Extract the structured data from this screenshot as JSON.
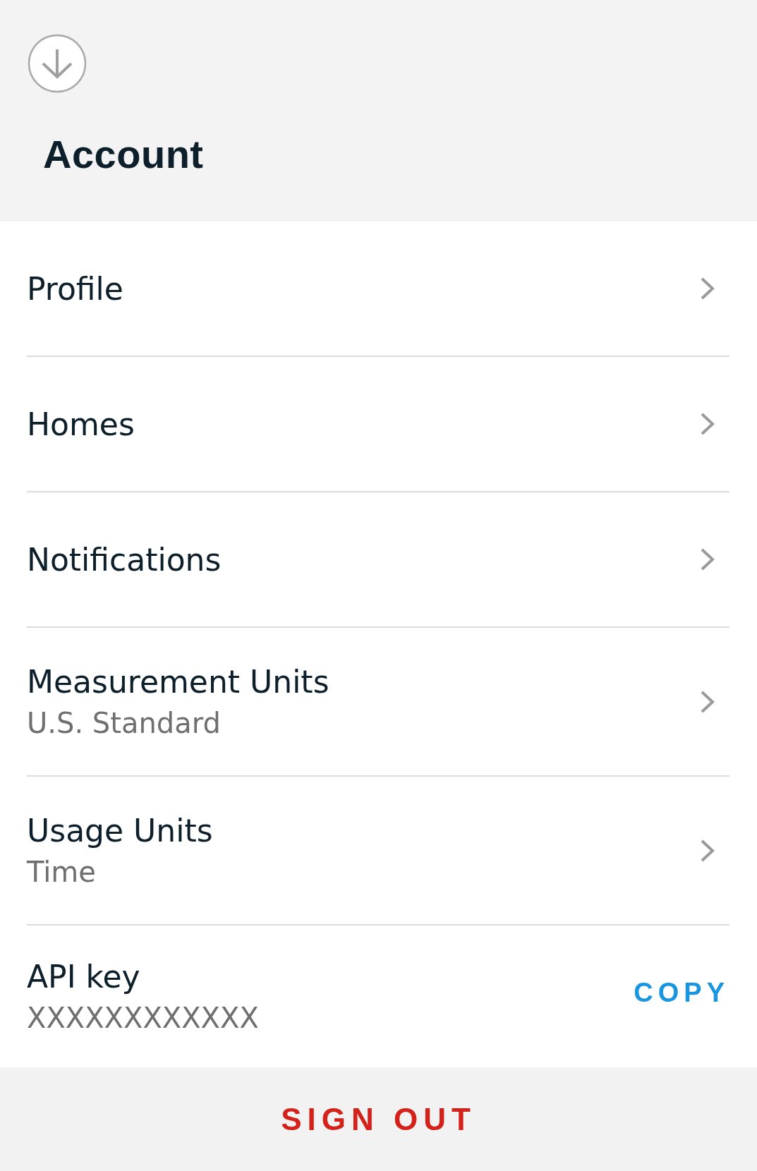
{
  "header": {
    "title": "Account"
  },
  "rows": [
    {
      "kind": "link",
      "label": "Profile"
    },
    {
      "kind": "link",
      "label": "Homes"
    },
    {
      "kind": "link",
      "label": "Notifications"
    },
    {
      "kind": "link",
      "label": "Measurement Units",
      "value": "U.S. Standard"
    },
    {
      "kind": "link",
      "label": "Usage Units",
      "value": "Time"
    },
    {
      "kind": "copy",
      "label": "API key",
      "value": "XXXXXXXXXXXX",
      "action": "COPY"
    }
  ],
  "sign_out": "SIGN OUT"
}
